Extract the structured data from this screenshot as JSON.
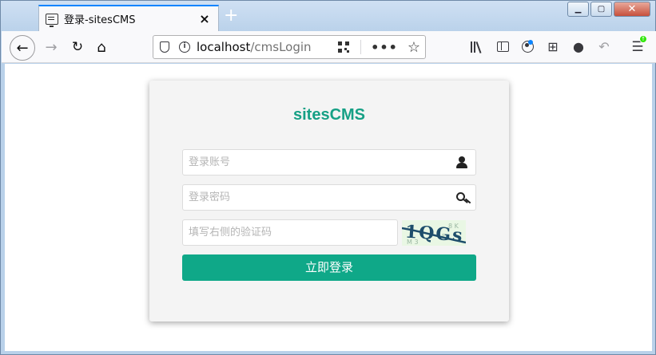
{
  "browser": {
    "tab_title": "登录-sitesCMS",
    "tab_close": "×",
    "new_tab": "+",
    "url_host": "localhost",
    "url_path": "/cmsLogin",
    "window_buttons": {
      "minimize": "▁",
      "maximize": "▢",
      "close": "✕"
    },
    "icons": [
      "back-arrow-icon",
      "forward-arrow-icon",
      "reload-icon",
      "home-icon",
      "shield-icon",
      "info-icon",
      "qr-code-icon",
      "more-icon",
      "bookmark-star-icon",
      "library-icon",
      "sidebar-icon",
      "account-icon",
      "crop-icon",
      "chat-icon",
      "undo-icon",
      "menu-icon"
    ]
  },
  "login": {
    "brand": "sitesCMS",
    "account_placeholder": "登录账号",
    "password_placeholder": "登录密码",
    "captcha_placeholder": "填写右侧的验证码",
    "captcha_text": "1QGs",
    "submit_label": "立即登录"
  },
  "colors": {
    "accent": "#0fa888",
    "brand_text": "#16a085",
    "card_bg": "#f4f4f4"
  }
}
